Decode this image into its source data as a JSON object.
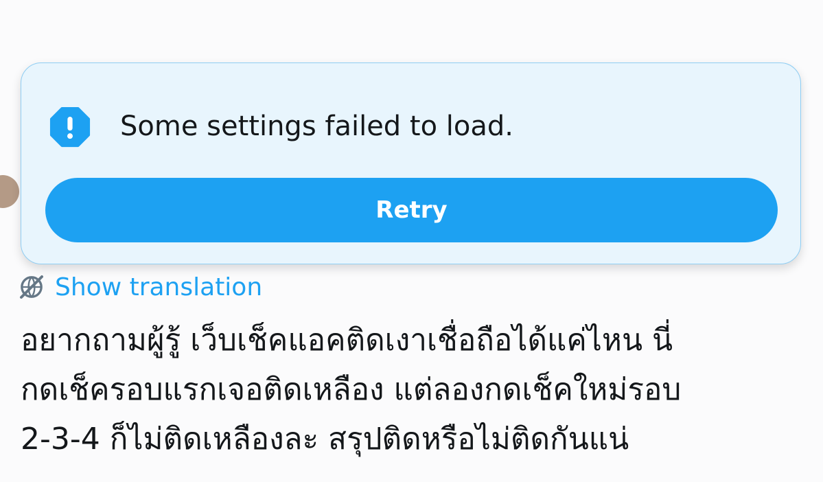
{
  "error_card": {
    "icon": "alert-octagon-icon",
    "message": "Some settings failed to load.",
    "retry_label": "Retry"
  },
  "translation": {
    "icon": "globe-off-icon",
    "label": "Show translation"
  },
  "tweet": {
    "lines": [
      "อยากถามผู้รู้ เว็บเช็คแอคติดเงาเชื่อถือได้แค่ไหน นี่",
      "กดเช็ครอบแรกเจอติดเหลือง แต่ลองกดเช็คใหม่รอบ",
      "2-3-4 ก็ไม่ติดเหลืองละ สรุปติดหรือไม่ติดกันแน่"
    ]
  },
  "colors": {
    "accent": "#1da1f2",
    "card_background": "#e8f5fd",
    "card_border": "#8ecdf3",
    "text": "#14171a"
  }
}
